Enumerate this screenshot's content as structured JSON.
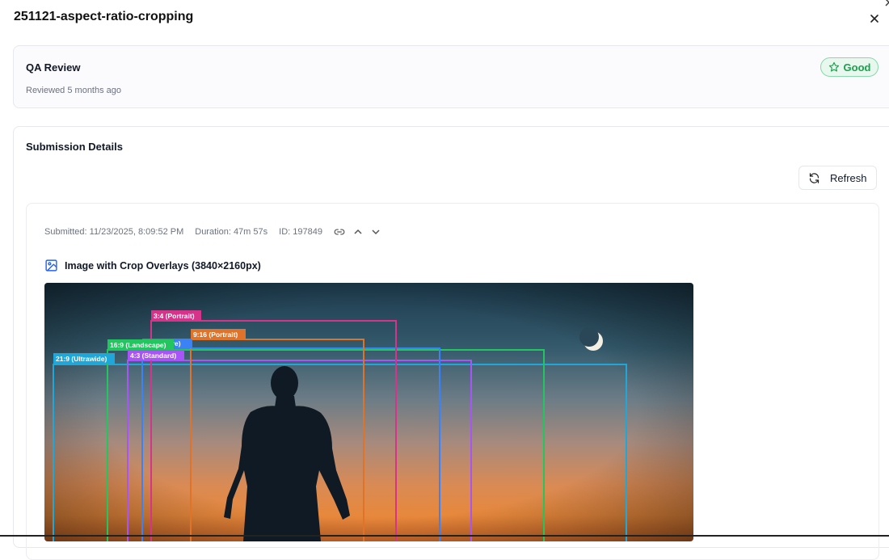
{
  "modal": {
    "title": "251121-aspect-ratio-cropping"
  },
  "qa_review": {
    "title": "QA Review",
    "reviewed": "Reviewed 5 months ago",
    "rating": "Good",
    "rating_color": "#16a34a"
  },
  "submission": {
    "title": "Submission Details",
    "refresh_label": "Refresh",
    "submitted": "Submitted: 11/23/2025, 8:09:52 PM",
    "duration": "Duration: 47m 57s",
    "id": "ID: 197849",
    "icons": [
      "link-icon",
      "chevron-up-icon",
      "chevron-down-icon",
      "refresh-icon",
      "image-icon",
      "star-icon",
      "close-icon"
    ],
    "image_heading": "Image with Crop Overlays (3840×2160px)",
    "crop_overlays": [
      {
        "label": "3:4 (Portrait)",
        "color": "#d6338a"
      },
      {
        "label": "9:16 (Portrait)",
        "color": "#e0732a"
      },
      {
        "label": "16:9 (Landscape)",
        "color": "#22c55e"
      },
      {
        "label": "4:3 (Standard)",
        "color": "#a855f7"
      },
      {
        "label": "21:9 (Ultrawide)",
        "color": "#1ea7d8"
      },
      {
        "label": "are)",
        "color": "#3b82f6"
      }
    ]
  }
}
